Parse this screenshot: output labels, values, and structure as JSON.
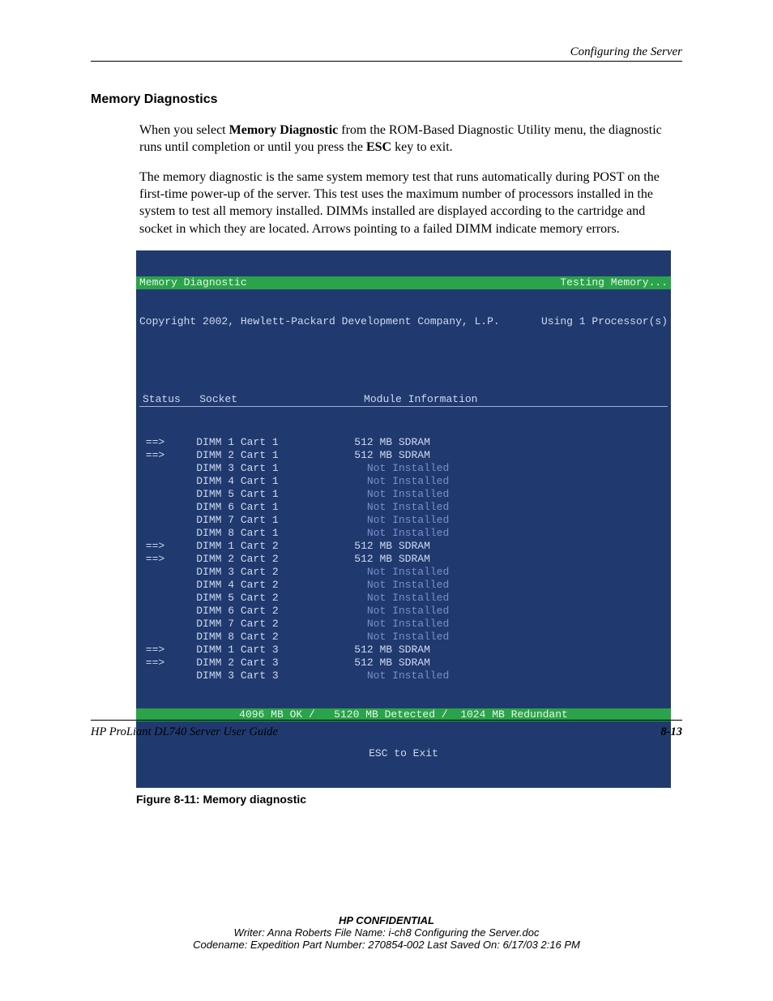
{
  "header": {
    "running": "Configuring the Server"
  },
  "section": {
    "title": "Memory Diagnostics"
  },
  "paragraphs": {
    "p1a": "When you select ",
    "p1b": "Memory Diagnostic",
    "p1c": " from the ROM-Based Diagnostic Utility menu, the diagnostic runs until completion or until you press the ",
    "p1d": "ESC",
    "p1e": " key to exit.",
    "p2": "The memory diagnostic is the same system memory test that runs automatically during POST on the first-time power-up of the server. This test uses the maximum number of processors installed in the system to test all memory installed. DIMMs installed are displayed according to the cartridge and socket in which they are located. Arrows pointing to a failed DIMM indicate memory errors."
  },
  "term": {
    "title_left": "Memory Diagnostic",
    "title_right": "Testing Memory...",
    "sub_left": "Copyright 2002, Hewlett-Packard Development Company, L.P.",
    "sub_right": "Using 1 Processor(s)",
    "col_head": "Status   Socket                    Module Information",
    "rows": [
      {
        "status": "==>",
        "socket": "DIMM 1 Cart 1",
        "info": "512 MB SDRAM",
        "installed": true
      },
      {
        "status": "==>",
        "socket": "DIMM 2 Cart 1",
        "info": "512 MB SDRAM",
        "installed": true
      },
      {
        "status": "",
        "socket": "DIMM 3 Cart 1",
        "info": "Not Installed",
        "installed": false
      },
      {
        "status": "",
        "socket": "DIMM 4 Cart 1",
        "info": "Not Installed",
        "installed": false
      },
      {
        "status": "",
        "socket": "DIMM 5 Cart 1",
        "info": "Not Installed",
        "installed": false
      },
      {
        "status": "",
        "socket": "DIMM 6 Cart 1",
        "info": "Not Installed",
        "installed": false
      },
      {
        "status": "",
        "socket": "DIMM 7 Cart 1",
        "info": "Not Installed",
        "installed": false
      },
      {
        "status": "",
        "socket": "DIMM 8 Cart 1",
        "info": "Not Installed",
        "installed": false
      },
      {
        "status": "==>",
        "socket": "DIMM 1 Cart 2",
        "info": "512 MB SDRAM",
        "installed": true
      },
      {
        "status": "==>",
        "socket": "DIMM 2 Cart 2",
        "info": "512 MB SDRAM",
        "installed": true
      },
      {
        "status": "",
        "socket": "DIMM 3 Cart 2",
        "info": "Not Installed",
        "installed": false
      },
      {
        "status": "",
        "socket": "DIMM 4 Cart 2",
        "info": "Not Installed",
        "installed": false
      },
      {
        "status": "",
        "socket": "DIMM 5 Cart 2",
        "info": "Not Installed",
        "installed": false
      },
      {
        "status": "",
        "socket": "DIMM 6 Cart 2",
        "info": "Not Installed",
        "installed": false
      },
      {
        "status": "",
        "socket": "DIMM 7 Cart 2",
        "info": "Not Installed",
        "installed": false
      },
      {
        "status": "",
        "socket": "DIMM 8 Cart 2",
        "info": "Not Installed",
        "installed": false
      },
      {
        "status": "==>",
        "socket": "DIMM 1 Cart 3",
        "info": "512 MB SDRAM",
        "installed": true
      },
      {
        "status": "==>",
        "socket": "DIMM 2 Cart 3",
        "info": "512 MB SDRAM",
        "installed": true
      },
      {
        "status": "",
        "socket": "DIMM 3 Cart 3",
        "info": "Not Installed",
        "installed": false
      }
    ],
    "foot1": "4096 MB OK /   5120 MB Detected /  1024 MB Redundant",
    "foot2": "ESC to Exit"
  },
  "figure": {
    "caption": "Figure 8-11:  Memory diagnostic"
  },
  "footer": {
    "guide": "HP ProLiant DL740 Server User Guide",
    "page": "8-13"
  },
  "confidential": {
    "title": "HP CONFIDENTIAL",
    "line1": "Writer: Anna Roberts File Name: i-ch8 Configuring the Server.doc",
    "line2": "Codename: Expedition Part Number: 270854-002 Last Saved On: 6/17/03 2:16 PM"
  }
}
